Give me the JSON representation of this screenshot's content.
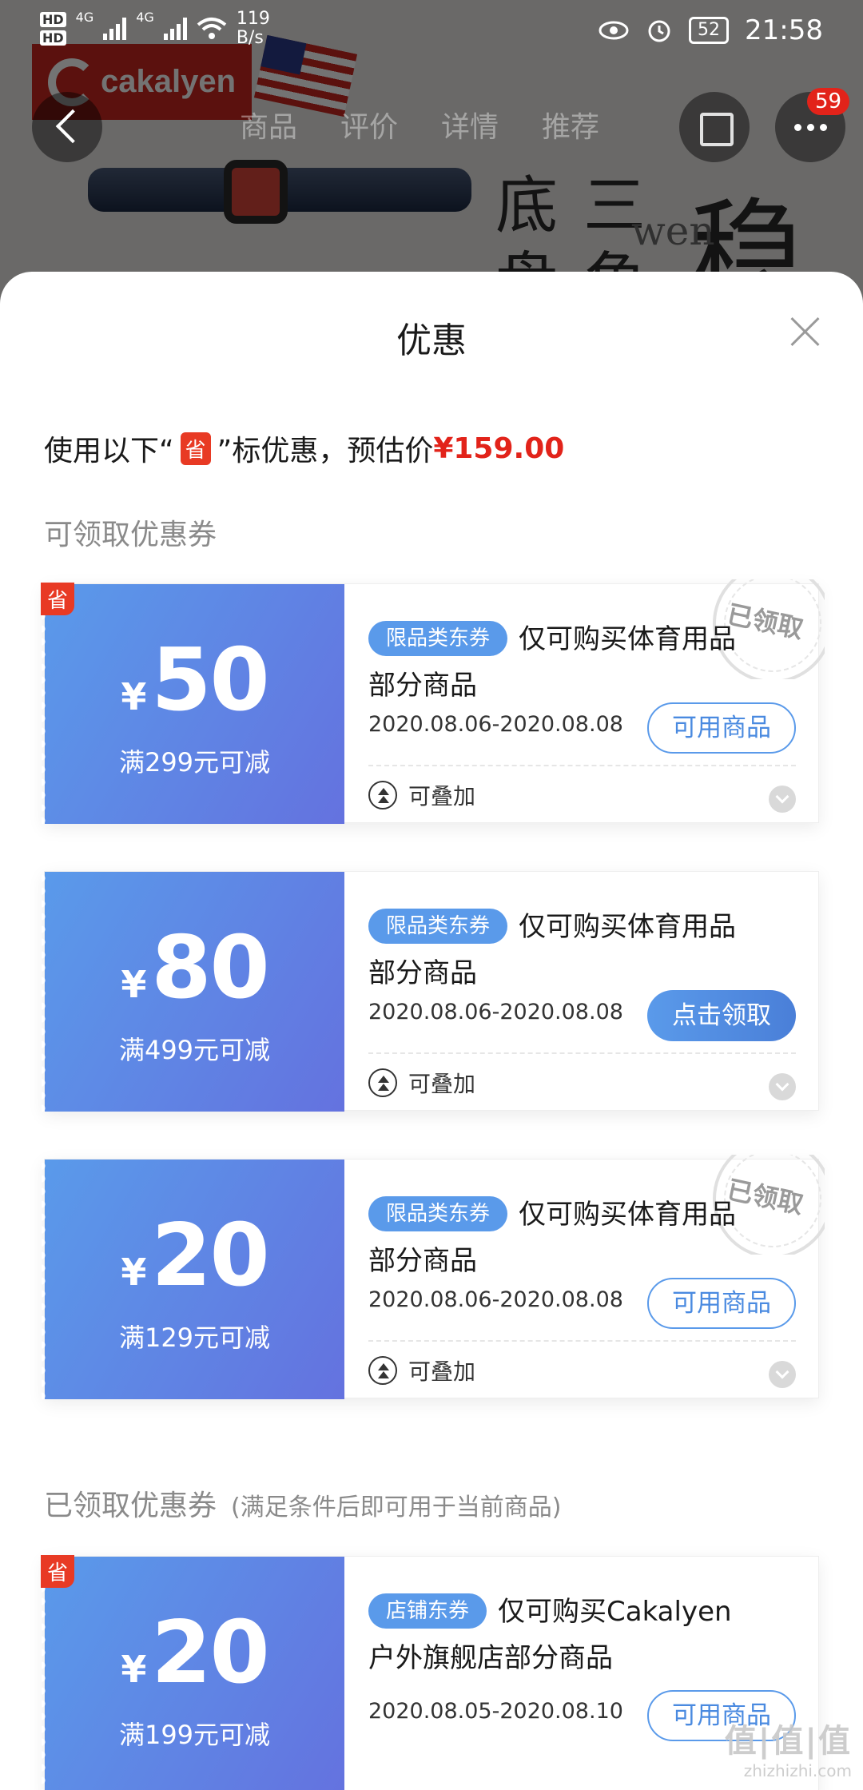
{
  "status_bar": {
    "network_1": "HD",
    "network_2": "HD",
    "net_type_1": "4G",
    "net_type_2": "4G",
    "speed_value": "119",
    "speed_unit": "B/s",
    "battery": "52",
    "time": "21:58"
  },
  "background": {
    "brand": "cakalyen",
    "nav_tabs": [
      "商品",
      "评价",
      "详情",
      "推荐"
    ],
    "more_badge": "59",
    "banner_chars": [
      "底",
      "三",
      "稳",
      "盘",
      "角",
      "wen"
    ]
  },
  "sheet": {
    "title": "优惠",
    "estimate_prefix": "使用以下“",
    "estimate_tag": "省",
    "estimate_suffix": "”标优惠，预估价",
    "estimate_price": "¥159.00",
    "available_title": "可领取优惠券",
    "received_title": "已领取优惠券",
    "received_note": "(满足条件后即可用于当前商品)"
  },
  "coupons": [
    {
      "corner_tag": "省",
      "currency": "¥",
      "amount": "50",
      "condition": "满299元可减",
      "tag": "限品类东券",
      "desc": "仅可购买体育用品部分商品",
      "date": "2020.08.06-2020.08.08",
      "button": "可用商品",
      "stamp": "已领取",
      "stack": "可叠加"
    },
    {
      "currency": "¥",
      "amount": "80",
      "condition": "满499元可减",
      "tag": "限品类东券",
      "desc": "仅可购买体育用品部分商品",
      "date": "2020.08.06-2020.08.08",
      "button": "点击领取",
      "stack": "可叠加"
    },
    {
      "currency": "¥",
      "amount": "20",
      "condition": "满129元可减",
      "tag": "限品类东券",
      "desc": "仅可购买体育用品部分商品",
      "date": "2020.08.06-2020.08.08",
      "button": "可用商品",
      "stamp": "已领取",
      "stack": "可叠加"
    },
    {
      "corner_tag": "省",
      "currency": "¥",
      "amount": "20",
      "condition": "满199元可减",
      "tag": "店铺东券",
      "desc": "仅可购买Cakalyen户外旗舰店部分商品",
      "date": "2020.08.05-2020.08.10",
      "button": "可用商品"
    }
  ],
  "watermark": {
    "mark": "值|值|值",
    "url": "zhizhizhi.com"
  },
  "colors": {
    "coupon_gradient_start": "#5a9aea",
    "coupon_gradient_end": "#6472df",
    "price_red": "#e2231a",
    "sheng_tag": "#e83a24"
  }
}
